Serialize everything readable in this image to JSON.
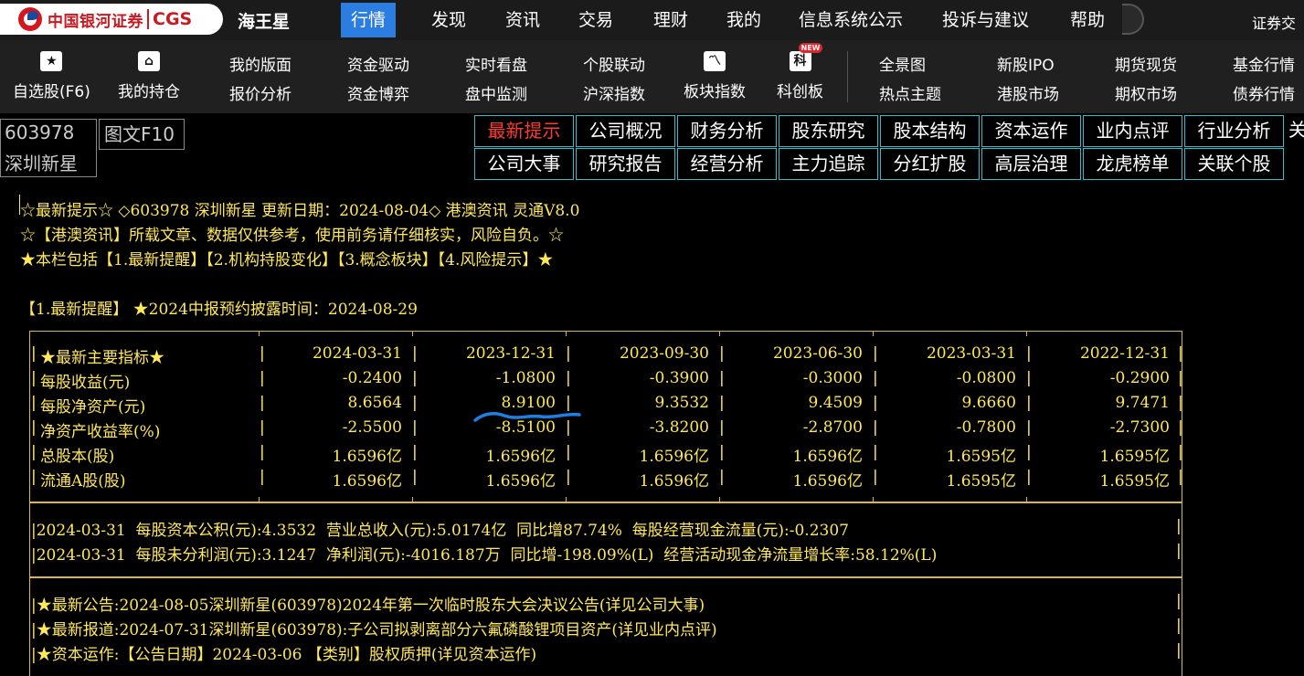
{
  "topbar": {
    "logo_text": "中国银河证券",
    "logo_cgs": "CGS",
    "app_name": "海王星",
    "menu": [
      "行情",
      "发现",
      "资讯",
      "交易",
      "理财",
      "我的",
      "信息系统公示",
      "投诉与建议",
      "帮助"
    ],
    "active_menu": "行情",
    "right_label": "证券交"
  },
  "toolbar": {
    "icon_items": [
      {
        "label": "自选股(F6)",
        "icon": "star-icon",
        "glyph": "★"
      },
      {
        "label": "我的持仓",
        "icon": "home-icon",
        "glyph": "⌂"
      },
      {
        "label": "板块指数",
        "icon": "trend-chart-icon",
        "glyph": "〽"
      },
      {
        "label": "科创板",
        "icon": "star-market-icon",
        "glyph": "科",
        "badge": "NEW"
      }
    ],
    "pairs": [
      [
        "我的版面",
        "报价分析"
      ],
      [
        "资金驱动",
        "资金博弈"
      ],
      [
        "实时看盘",
        "盘中监测"
      ],
      [
        "个股联动",
        "沪深指数"
      ],
      [
        "全景图",
        "热点主题"
      ],
      [
        "新股IPO",
        "港股市场"
      ],
      [
        "期货现货",
        "期权市场"
      ],
      [
        "基金行情",
        "债券行情"
      ]
    ]
  },
  "stock": {
    "code": "603978",
    "name": "深圳新星",
    "f10_tab": "图文F10"
  },
  "categories": {
    "row1": [
      "最新提示",
      "公司概况",
      "财务分析",
      "股东研究",
      "股本结构",
      "资本运作",
      "业内点评",
      "行业分析"
    ],
    "row2": [
      "公司大事",
      "研究报告",
      "经营分析",
      "主力追踪",
      "分红扩股",
      "高层治理",
      "龙虎榜单",
      "关联个股"
    ],
    "active": "最新提示",
    "overflow": "关"
  },
  "content": {
    "header_lines": [
      "☆最新提示☆ ◇603978 深圳新星 更新日期：2024-08-04◇ 港澳资讯 灵通V8.0",
      "☆【港澳资讯】所载文章、数据仅供参考，使用前务请仔细核实，风险自负。☆",
      "★本栏包括【1.最新提醒】【2.机构持股变化】【3.概念板块】【4.风险提示】★"
    ],
    "section_title": "【1.最新提醒】 ★2024中报预约披露时间：2024-08-29",
    "table": {
      "header_label": "★最新主要指标★",
      "dates": [
        "2024-03-31",
        "2023-12-31",
        "2023-09-30",
        "2023-06-30",
        "2023-03-31",
        "2022-12-31"
      ],
      "rows": [
        {
          "label": "每股收益(元)",
          "values": [
            "-0.2400",
            "-1.0800",
            "-0.3900",
            "-0.3000",
            "-0.0800",
            "-0.2900"
          ]
        },
        {
          "label": "每股净资产(元)",
          "values": [
            "8.6564",
            "8.9100",
            "9.3532",
            "9.4509",
            "9.6660",
            "9.7471"
          ]
        },
        {
          "label": "净资产收益率(%)",
          "values": [
            "-2.5500",
            "-8.5100",
            "-3.8200",
            "-2.8700",
            "-0.7800",
            "-2.7300"
          ]
        },
        {
          "label": "总股本(股)",
          "values": [
            "1.6596亿",
            "1.6596亿",
            "1.6596亿",
            "1.6596亿",
            "1.6595亿",
            "1.6595亿"
          ]
        },
        {
          "label": "流通A股(股)",
          "values": [
            "1.6596亿",
            "1.6596亿",
            "1.6596亿",
            "1.6596亿",
            "1.6595亿",
            "1.6595亿"
          ]
        }
      ]
    },
    "summary_lines": [
      "2024-03-31  每股资本公积(元):4.3532  营业总收入(元):5.0174亿  同比增87.74%  每股经营现金流量(元):-0.2307",
      "2024-03-31  每股未分利润(元):3.1247  净利润(元):-4016.187万  同比增-198.09%(L)  经营活动现金净流量增长率:58.12%(L)"
    ],
    "news_lines": [
      "★最新公告:2024-08-05深圳新星(603978)2024年第一次临时股东大会决议公告(详见公司大事)",
      "★最新报道:2024-07-31深圳新星(603978):子公司拟剥离部分六氟磷酸锂项目资产(详见业内点评)",
      "★资本运作:【公告日期】2024-03-06 【类别】股权质押(详见资本运作)"
    ]
  },
  "colors": {
    "text_yellow": "#ffe85a",
    "border_gold": "#d9b84a",
    "tab_cyan": "#2ac0d0",
    "active_red": "#ff3b30",
    "menu_active_blue": "#2b7de1",
    "annotation_blue": "#1e7fe0"
  }
}
